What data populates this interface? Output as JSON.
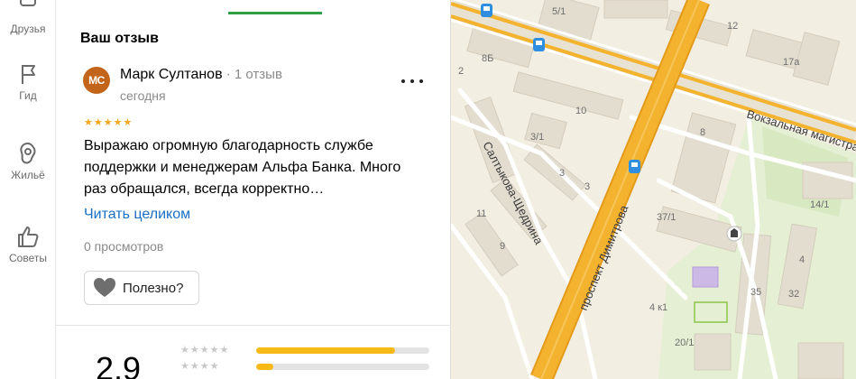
{
  "rail": {
    "items": [
      {
        "label": "Друзья",
        "icon": "friends-icon"
      },
      {
        "label": "Гид",
        "icon": "flag-icon"
      },
      {
        "label": "Жильё",
        "icon": "housing-icon"
      },
      {
        "label": "Советы",
        "icon": "thumbs-up-icon"
      }
    ]
  },
  "panel": {
    "section_title": "Ваш отзыв",
    "review": {
      "avatar_initials": "МС",
      "avatar_color": "#c2651a",
      "author": "Марк Султанов",
      "separator": "·",
      "review_count": "1 отзыв",
      "date": "сегодня",
      "rating_stars": 5,
      "text": "Выражаю огромную благодарность службе поддержки и менеджерам Альфа Банка. Много раз обращался, всегда корректно…",
      "read_more": "Читать целиком",
      "views": "0 просмотров",
      "useful_label": "Полезно?"
    },
    "summary": {
      "rating": "2,9",
      "distribution": [
        {
          "stars": 5,
          "fraction": 0.8
        },
        {
          "stars": 4,
          "fraction": 0.1
        }
      ]
    }
  },
  "map": {
    "streets": [
      "Вокзальная магистраль",
      "проспект Димитрова",
      "Салтыкова-Щедрина"
    ],
    "house_numbers": [
      "5/1",
      "8Б",
      "10",
      "12",
      "17а",
      "3/1",
      "3",
      "3",
      "8",
      "11",
      "9",
      "37/1",
      "14/1",
      "4",
      "35",
      "32",
      "4 к1",
      "20/1",
      "2"
    ],
    "accent_colors": {
      "major_road": "#f4b32f",
      "road_casing": "#e49a1a",
      "park": "#dfecc9",
      "transit": "#2f8ee0"
    }
  }
}
